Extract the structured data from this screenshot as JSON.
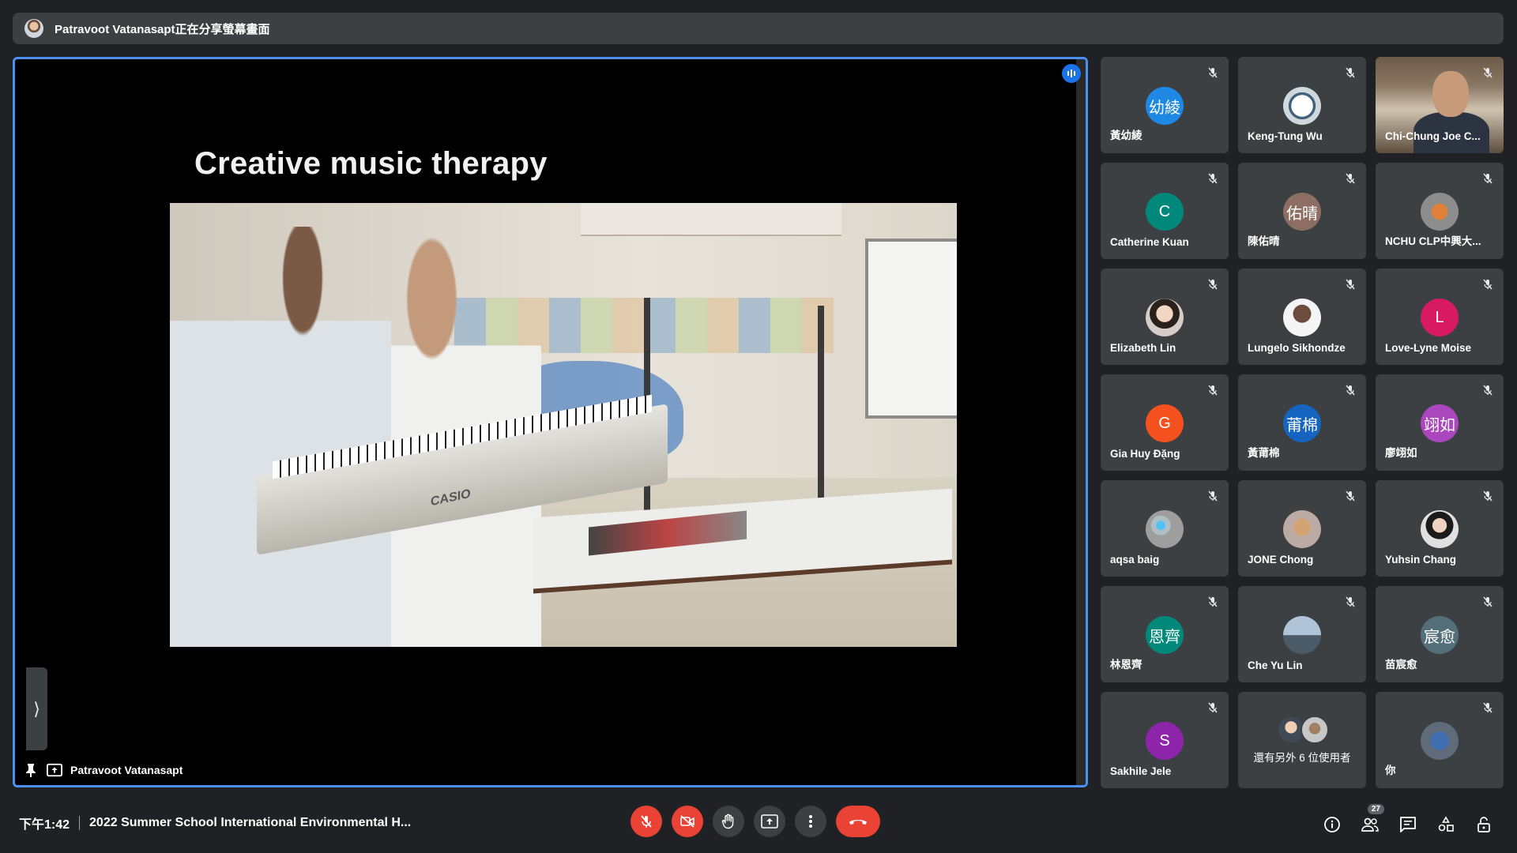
{
  "top_banner": {
    "text": "Patravoot Vatanasapt正在分享螢幕畫面"
  },
  "presentation": {
    "slide_title": "Creative music therapy",
    "photo_brand_text": "CASIO",
    "presenter_label": "Patravoot Vatanasapt"
  },
  "participants": [
    {
      "name": "黃幼綾",
      "avatar_text": "幼綾",
      "avatar_color": "#1e88e5",
      "type": "initials"
    },
    {
      "name": "Keng-Tung Wu",
      "avatar_text": "",
      "avatar_color": "#cfd8dc",
      "type": "photo"
    },
    {
      "name": "Chi-Chung Joe C...",
      "avatar_text": "",
      "avatar_color": "",
      "type": "video"
    },
    {
      "name": "Catherine Kuan",
      "avatar_text": "C",
      "avatar_color": "#00897b",
      "type": "initials"
    },
    {
      "name": "陳佑晴",
      "avatar_text": "佑晴",
      "avatar_color": "#8d6e63",
      "type": "initials"
    },
    {
      "name": "NCHU CLP中興大...",
      "avatar_text": "",
      "avatar_color": "#8d8d8d",
      "type": "photo"
    },
    {
      "name": "Elizabeth Lin",
      "avatar_text": "",
      "avatar_color": "#d7ccc8",
      "type": "photo"
    },
    {
      "name": "Lungelo Sikhondze",
      "avatar_text": "",
      "avatar_color": "#795548",
      "type": "photo"
    },
    {
      "name": "Love-Lyne Moise",
      "avatar_text": "L",
      "avatar_color": "#d81b60",
      "type": "initials"
    },
    {
      "name": "Gia Huy Đặng",
      "avatar_text": "G",
      "avatar_color": "#f4511e",
      "type": "initials"
    },
    {
      "name": "黃莆棉",
      "avatar_text": "莆棉",
      "avatar_color": "#1565c0",
      "type": "initials"
    },
    {
      "name": "廖翊如",
      "avatar_text": "翊如",
      "avatar_color": "#ab47bc",
      "type": "initials"
    },
    {
      "name": "aqsa baig",
      "avatar_text": "",
      "avatar_color": "#b0bec5",
      "type": "photo"
    },
    {
      "name": "JONE Chong",
      "avatar_text": "",
      "avatar_color": "#bcaaa4",
      "type": "photo"
    },
    {
      "name": "Yuhsin Chang",
      "avatar_text": "",
      "avatar_color": "#e0e0e0",
      "type": "photo"
    },
    {
      "name": "林恩齊",
      "avatar_text": "恩齊",
      "avatar_color": "#00897b",
      "type": "initials"
    },
    {
      "name": "Che Yu Lin",
      "avatar_text": "",
      "avatar_color": "#90a4ae",
      "type": "photo"
    },
    {
      "name": "苗宸愈",
      "avatar_text": "宸愈",
      "avatar_color": "#546e7a",
      "type": "initials"
    },
    {
      "name": "Sakhile Jele",
      "avatar_text": "S",
      "avatar_color": "#8e24aa",
      "type": "initials"
    },
    {
      "name": "還有另外 6 位使用者",
      "avatar_text": "",
      "avatar_color": "",
      "type": "more"
    },
    {
      "name": "你",
      "avatar_text": "",
      "avatar_color": "#5f6b7a",
      "type": "photo"
    }
  ],
  "bottom_bar": {
    "time": "下午1:42",
    "meeting_title": "2022 Summer School International Environmental H...",
    "participant_count": "27",
    "controls": [
      "mic-off-icon",
      "camera-off-icon",
      "raise-hand-icon",
      "present-icon",
      "more-options-icon",
      "end-call-icon"
    ],
    "right_icons": [
      "info-icon",
      "people-icon",
      "chat-icon",
      "activities-icon",
      "host-controls-icon"
    ]
  },
  "colors": {
    "accent": "#4b8ff1",
    "danger": "#ea4335",
    "tile_bg": "#3c4043",
    "bg": "#202124"
  }
}
